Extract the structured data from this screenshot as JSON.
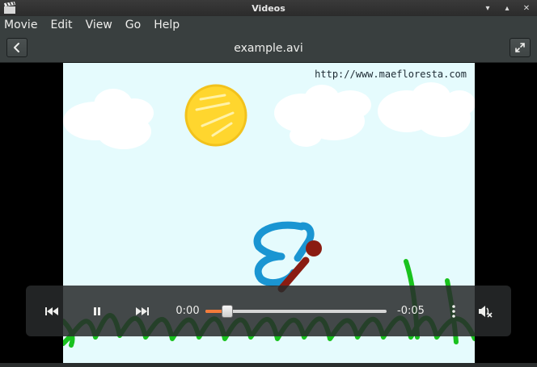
{
  "window": {
    "title": "Videos",
    "controls": {
      "minimize": "▾",
      "maximize": "▴",
      "close": "✕"
    }
  },
  "menubar": {
    "items": [
      "Movie",
      "Edit",
      "Go",
      "Help"
    ],
    "view_label": "View"
  },
  "header": {
    "title": "example.avi",
    "back_icon": "go-previous-icon",
    "fullscreen_icon": "view-fullscreen-icon"
  },
  "video": {
    "watermark": "http://www.maefloresta.com"
  },
  "playback": {
    "elapsed": "0:00",
    "remaining": "-0:05",
    "progress": 0.12,
    "accent_color": "#f57b3a"
  }
}
